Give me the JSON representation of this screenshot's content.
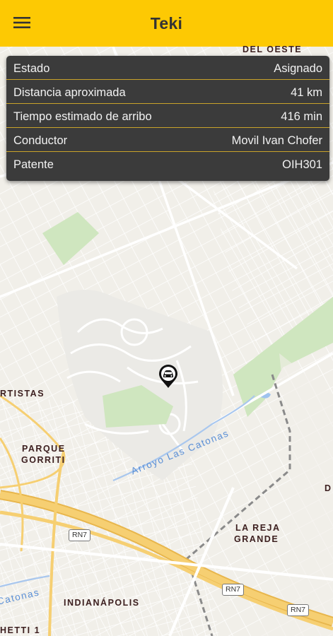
{
  "app": {
    "title": "Teki"
  },
  "trip_info": {
    "rows": [
      {
        "label": "Estado",
        "value": "Asignado"
      },
      {
        "label": "Distancia aproximada",
        "value": "41 km"
      },
      {
        "label": "Tiempo estimado de arribo",
        "value": "416 min"
      },
      {
        "label": "Conductor",
        "value": "Movil Ivan Chofer"
      },
      {
        "label": "Patente",
        "value": "OIH301"
      }
    ]
  },
  "map": {
    "labels": {
      "del_oeste": "DEL OESTE",
      "artistas": "RTISTAS",
      "parque_gorriti_1": "PARQUE",
      "parque_gorriti_2": "GORRITI",
      "la_reja_1": "LA REJA",
      "la_reja_2": "GRANDE",
      "indianapolis": "INDIANÁPOLIS",
      "hetti": "HETTI 1",
      "edge_d": "D"
    },
    "waterways": {
      "arroyo": "Arroyo Las Catonas",
      "catonas_edge": "Catonas"
    },
    "route_shields": [
      "RN7",
      "RN7",
      "RN7"
    ]
  },
  "colors": {
    "appbar": "#fdc903",
    "card_bg": "#3b3b3b",
    "card_divider": "#c9a32a",
    "park": "#cfe6bf",
    "highway": "#f6cf72"
  }
}
